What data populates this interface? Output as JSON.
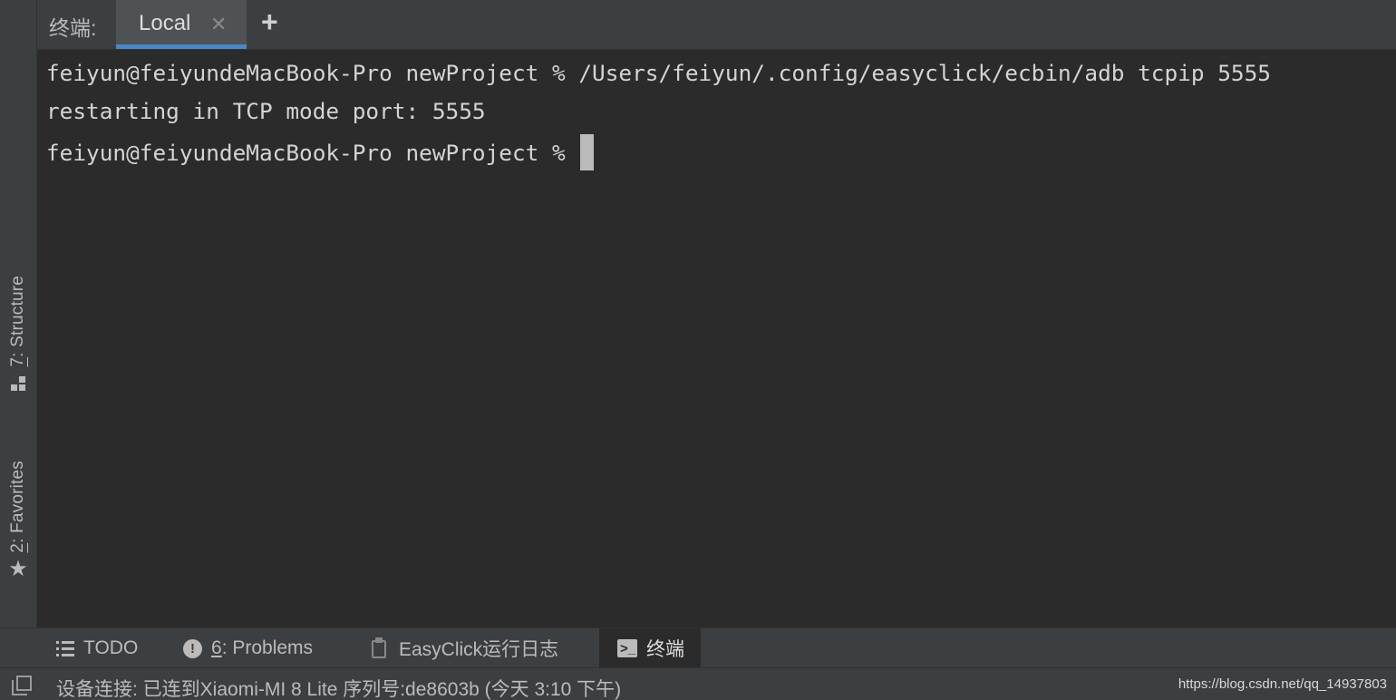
{
  "left_stripe": {
    "structure_label_prefix": "7",
    "structure_label_rest": ": Structure",
    "favorites_label_prefix": "2",
    "favorites_label_rest": ": Favorites",
    "structure_icon": "structure-icon",
    "favorites_icon": "star-icon"
  },
  "header": {
    "title": "终端:",
    "tabs": [
      {
        "label": "Local",
        "active": true,
        "close_icon": "close-icon"
      }
    ],
    "add_tab_glyph": "+"
  },
  "terminal": {
    "lines": [
      "feiyun@feiyundeMacBook-Pro newProject % /Users/feiyun/.config/easyclick/ecbin/adb tcpip 5555",
      "restarting in TCP mode port: 5555",
      "feiyun@feiyundeMacBook-Pro newProject % "
    ]
  },
  "tool_bar": {
    "items": [
      {
        "label": "TODO",
        "icon": "list-icon"
      },
      {
        "label_prefix": "6",
        "label_rest": ": Problems",
        "icon": "info-icon"
      },
      {
        "label": "EasyClick运行日志",
        "icon": "clipboard-icon"
      },
      {
        "label": "终端",
        "icon": "terminal-icon",
        "active": true
      }
    ]
  },
  "status_bar": {
    "text": "设备连接: 已连到Xiaomi-MI 8 Lite 序列号:de8603b (今天 3:10 下午)",
    "watermark": "https://blog.csdn.net/qq_14937803"
  },
  "colors": {
    "background": "#2b2b2b",
    "panel": "#3c3f41",
    "accent": "#4a88c7",
    "text": "#bbbbbb"
  }
}
